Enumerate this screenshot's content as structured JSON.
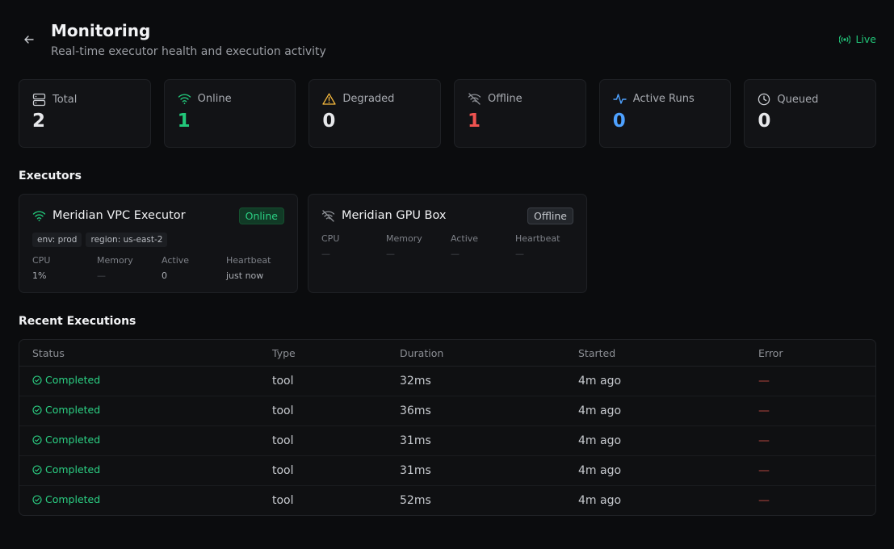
{
  "header": {
    "title": "Monitoring",
    "subtitle": "Real-time executor health and execution activity",
    "live_label": "Live"
  },
  "stats": [
    {
      "label": "Total",
      "value": "2",
      "icon": "server-icon",
      "color": "#e6e7ea"
    },
    {
      "label": "Online",
      "value": "1",
      "icon": "wifi-icon",
      "color": "#22c77a"
    },
    {
      "label": "Degraded",
      "value": "0",
      "icon": "warning-icon",
      "color": "#e6e7ea"
    },
    {
      "label": "Offline",
      "value": "1",
      "icon": "wifi-off-icon",
      "color": "#ef5350"
    },
    {
      "label": "Active Runs",
      "value": "0",
      "icon": "activity-icon",
      "color": "#4ea1ff"
    },
    {
      "label": "Queued",
      "value": "0",
      "icon": "clock-icon",
      "color": "#e6e7ea"
    }
  ],
  "executors_section": {
    "title": "Executors",
    "items": [
      {
        "name": "Meridian VPC Executor",
        "status": "Online",
        "icon": "wifi-icon",
        "tags": [
          "env: prod",
          "region: us-east-2"
        ],
        "metrics": [
          {
            "label": "CPU",
            "value": "1%"
          },
          {
            "label": "Memory",
            "value": "—"
          },
          {
            "label": "Active",
            "value": "0"
          },
          {
            "label": "Heartbeat",
            "value": "just now"
          }
        ]
      },
      {
        "name": "Meridian GPU Box",
        "status": "Offline",
        "icon": "wifi-off-icon",
        "tags": [],
        "metrics": [
          {
            "label": "CPU",
            "value": "—"
          },
          {
            "label": "Memory",
            "value": "—"
          },
          {
            "label": "Active",
            "value": "—"
          },
          {
            "label": "Heartbeat",
            "value": "—"
          }
        ]
      }
    ]
  },
  "recent_section": {
    "title": "Recent Executions",
    "columns": [
      "Status",
      "Type",
      "Duration",
      "Started",
      "Error"
    ],
    "rows": [
      {
        "status": "Completed",
        "type": "tool",
        "duration": "32ms",
        "started": "4m ago",
        "error": "—"
      },
      {
        "status": "Completed",
        "type": "tool",
        "duration": "36ms",
        "started": "4m ago",
        "error": "—"
      },
      {
        "status": "Completed",
        "type": "tool",
        "duration": "31ms",
        "started": "4m ago",
        "error": "—"
      },
      {
        "status": "Completed",
        "type": "tool",
        "duration": "31ms",
        "started": "4m ago",
        "error": "—"
      },
      {
        "status": "Completed",
        "type": "tool",
        "duration": "52ms",
        "started": "4m ago",
        "error": "—"
      }
    ]
  },
  "colors": {
    "success": "#22c77a",
    "danger": "#ef5350",
    "accent": "#4ea1ff",
    "warning": "#f5b83d"
  }
}
